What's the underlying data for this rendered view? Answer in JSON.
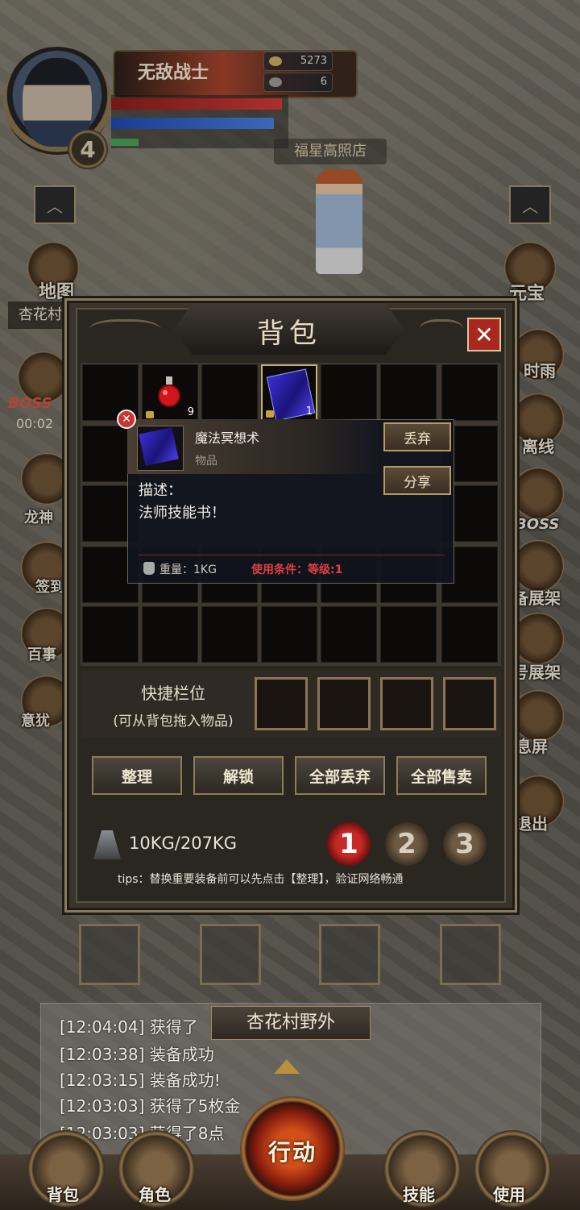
{
  "hud": {
    "player_name": "无敌战士",
    "level": "4",
    "gold": "5273",
    "ingot": "6",
    "shop_label": "福星高照店"
  },
  "side_left": {
    "map_label": "地图",
    "village_label": "杏花村",
    "boss_label": "BOSS",
    "timer": "00:02",
    "items": [
      "龙神",
      "签到",
      "百事",
      "意犹"
    ]
  },
  "side_right": {
    "items": [
      "元宝",
      "时雨",
      "离线",
      "BOSS",
      "备展架",
      "号展架",
      "息屏",
      "退出"
    ]
  },
  "bag": {
    "title": "背包",
    "close_label": "✕",
    "slots": [
      {
        "item": "potion",
        "count": "9",
        "locked": true
      },
      {
        "item": "skill-book",
        "count": "1",
        "locked": true
      }
    ],
    "quick_title": "快捷栏位",
    "quick_sub": "(可从背包拖入物品)",
    "actions": [
      "整理",
      "解锁",
      "全部丢弃",
      "全部售卖"
    ],
    "weight": "10KG/207KG",
    "pages": [
      "1",
      "2",
      "3"
    ],
    "active_page": "1",
    "tips": "tips：替换重要装备前可以先点击【整理】，验证网络畅通"
  },
  "tooltip": {
    "name": "魔法冥想术",
    "type": "物品",
    "discard_label": "丢弃",
    "share_label": "分享",
    "desc_label": "描述：",
    "desc": "法师技能书！",
    "weight": "重量：1KG",
    "requirement": "使用条件：等级:1"
  },
  "log": {
    "location": "杏花村野外",
    "lines": [
      "[12:04:04] 获得了",
      "[12:03:38] 装备成功",
      "[12:03:15] 装备成功!",
      "[12:03:03] 获得了5枚金",
      "[12:03:03] 获得了8点"
    ]
  },
  "bottom_nav": {
    "bag": "背包",
    "role": "角色",
    "action": "行动",
    "skill": "技能",
    "use": "使用"
  },
  "colors": {
    "accent_red": "#a8281e",
    "requirement_red": "#e0403e",
    "frame_gold": "#8a7b5e"
  }
}
